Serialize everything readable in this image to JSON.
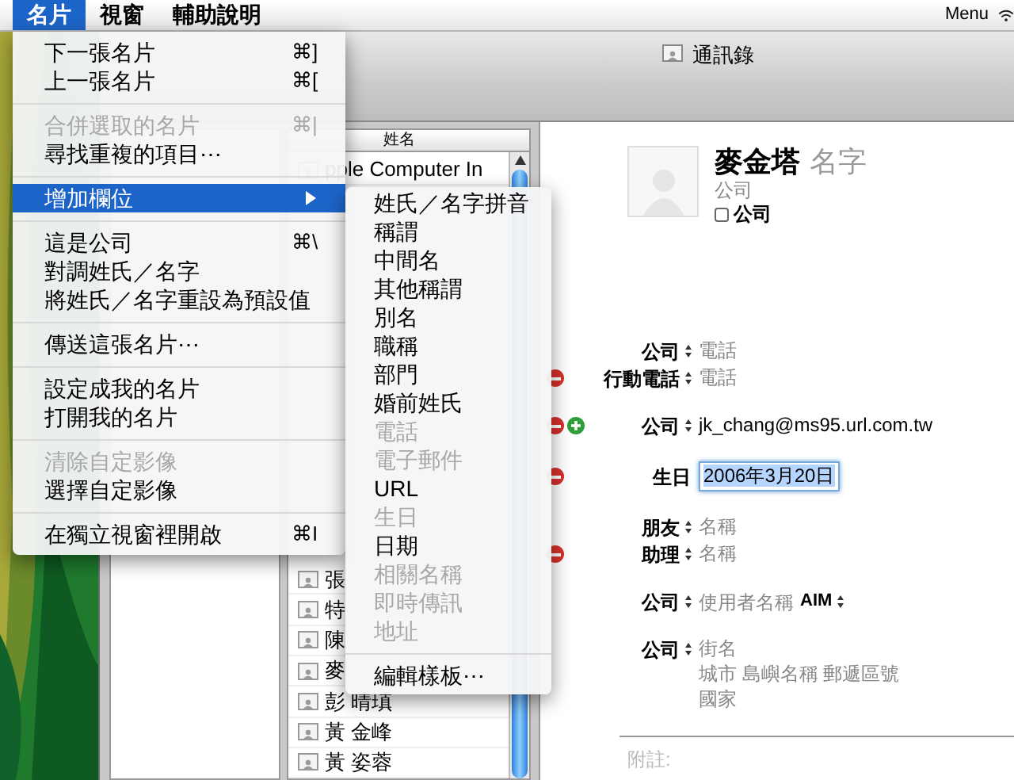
{
  "menu_bar": {
    "items": [
      {
        "label": "名片",
        "selected": true
      },
      {
        "label": "視窗",
        "selected": false
      },
      {
        "label": "輔助說明",
        "selected": false
      }
    ],
    "right_label": "Menu"
  },
  "card_menu": {
    "items": [
      {
        "kind": "item",
        "label": "下一張名片",
        "shortcut": "⌘]",
        "disabled": false,
        "selected": false
      },
      {
        "kind": "item",
        "label": "上一張名片",
        "shortcut": "⌘[",
        "disabled": false,
        "selected": false
      },
      {
        "kind": "separator"
      },
      {
        "kind": "item",
        "label": "合併選取的名片",
        "shortcut": "⌘|",
        "disabled": true,
        "selected": false
      },
      {
        "kind": "item",
        "label": "尋找重複的項目⋯",
        "disabled": false,
        "selected": false
      },
      {
        "kind": "separator"
      },
      {
        "kind": "submenu",
        "label": "增加欄位",
        "disabled": false,
        "selected": true
      },
      {
        "kind": "separator"
      },
      {
        "kind": "item",
        "label": "這是公司",
        "shortcut": "⌘\\",
        "disabled": false,
        "selected": false
      },
      {
        "kind": "item",
        "label": "對調姓氏／名字",
        "disabled": false,
        "selected": false
      },
      {
        "kind": "item",
        "label": "將姓氏／名字重設為預設值",
        "disabled": false,
        "selected": false
      },
      {
        "kind": "separator"
      },
      {
        "kind": "item",
        "label": "傳送這張名片⋯",
        "disabled": false,
        "selected": false
      },
      {
        "kind": "separator"
      },
      {
        "kind": "item",
        "label": "設定成我的名片",
        "disabled": false,
        "selected": false
      },
      {
        "kind": "item",
        "label": "打開我的名片",
        "disabled": false,
        "selected": false
      },
      {
        "kind": "separator"
      },
      {
        "kind": "item",
        "label": "清除自定影像",
        "disabled": true,
        "selected": false
      },
      {
        "kind": "item",
        "label": "選擇自定影像",
        "disabled": false,
        "selected": false
      },
      {
        "kind": "separator"
      },
      {
        "kind": "item",
        "label": "在獨立視窗裡開啟",
        "shortcut": "⌘I",
        "disabled": false,
        "selected": false
      }
    ]
  },
  "add_field_submenu": {
    "items": [
      {
        "kind": "item",
        "label": "姓氏／名字拼音",
        "disabled": false
      },
      {
        "kind": "item",
        "label": "稱謂",
        "disabled": false
      },
      {
        "kind": "item",
        "label": "中間名",
        "disabled": false
      },
      {
        "kind": "item",
        "label": "其他稱謂",
        "disabled": false
      },
      {
        "kind": "item",
        "label": "別名",
        "disabled": false
      },
      {
        "kind": "item",
        "label": "職稱",
        "disabled": false
      },
      {
        "kind": "item",
        "label": "部門",
        "disabled": false
      },
      {
        "kind": "item",
        "label": "婚前姓氏",
        "disabled": false
      },
      {
        "kind": "item",
        "label": "電話",
        "disabled": true
      },
      {
        "kind": "item",
        "label": "電子郵件",
        "disabled": true
      },
      {
        "kind": "item",
        "label": "URL",
        "disabled": false
      },
      {
        "kind": "item",
        "label": "生日",
        "disabled": true
      },
      {
        "kind": "item",
        "label": "日期",
        "disabled": false
      },
      {
        "kind": "item",
        "label": "相關名稱",
        "disabled": true
      },
      {
        "kind": "item",
        "label": "即時傳訊",
        "disabled": true
      },
      {
        "kind": "item",
        "label": "地址",
        "disabled": true
      },
      {
        "kind": "separator"
      },
      {
        "kind": "item",
        "label": "編輯樣板⋯",
        "disabled": false
      }
    ]
  },
  "window": {
    "title": "通訊錄"
  },
  "name_list": {
    "column_header": "姓名",
    "top_rows": [
      {
        "name": "pple Computer In"
      }
    ],
    "bottom_rows": [
      {
        "name": "張"
      },
      {
        "name": "特"
      },
      {
        "name": "陳"
      },
      {
        "name": "麥"
      },
      {
        "name": "彭 晴瑱"
      },
      {
        "name": "黃 金峰"
      },
      {
        "name": "黃 姿蓉"
      }
    ]
  },
  "card": {
    "name": "麥金塔",
    "name_placeholder": "名字",
    "company_placeholder": "公司",
    "company_checkbox": {
      "label": "公司",
      "checked": false
    },
    "field_groups": [
      {
        "fields": [
          {
            "kind": "text",
            "label": "公司",
            "placeholder": "電話",
            "removable": false,
            "addable": false
          },
          {
            "kind": "text",
            "label": "行動電話",
            "placeholder": "電話",
            "removable": true,
            "addable": false
          }
        ]
      },
      {
        "fields": [
          {
            "kind": "text",
            "label": "公司",
            "value": "jk_chang@ms95.url.com.tw",
            "removable": true,
            "addable": true
          }
        ]
      },
      {
        "fields": [
          {
            "kind": "date",
            "label": "生日",
            "value": "2006年3月20日",
            "removable": true,
            "addable": false
          }
        ]
      },
      {
        "fields": [
          {
            "kind": "text",
            "label": "朋友",
            "placeholder": "名稱",
            "removable": false,
            "addable": false
          },
          {
            "kind": "text",
            "label": "助理",
            "placeholder": "名稱",
            "removable": true,
            "addable": false
          }
        ]
      },
      {
        "fields": [
          {
            "kind": "im",
            "label": "公司",
            "placeholder": "使用者名稱",
            "service": "AIM",
            "removable": false,
            "addable": false
          }
        ]
      },
      {
        "fields": [
          {
            "kind": "address",
            "label": "公司",
            "placeholder_lines": [
              "街名",
              "城市 島嶼名稱 郵遞區號",
              "國家"
            ],
            "removable": false,
            "addable": false
          }
        ]
      }
    ],
    "note_placeholder": "附註:"
  }
}
